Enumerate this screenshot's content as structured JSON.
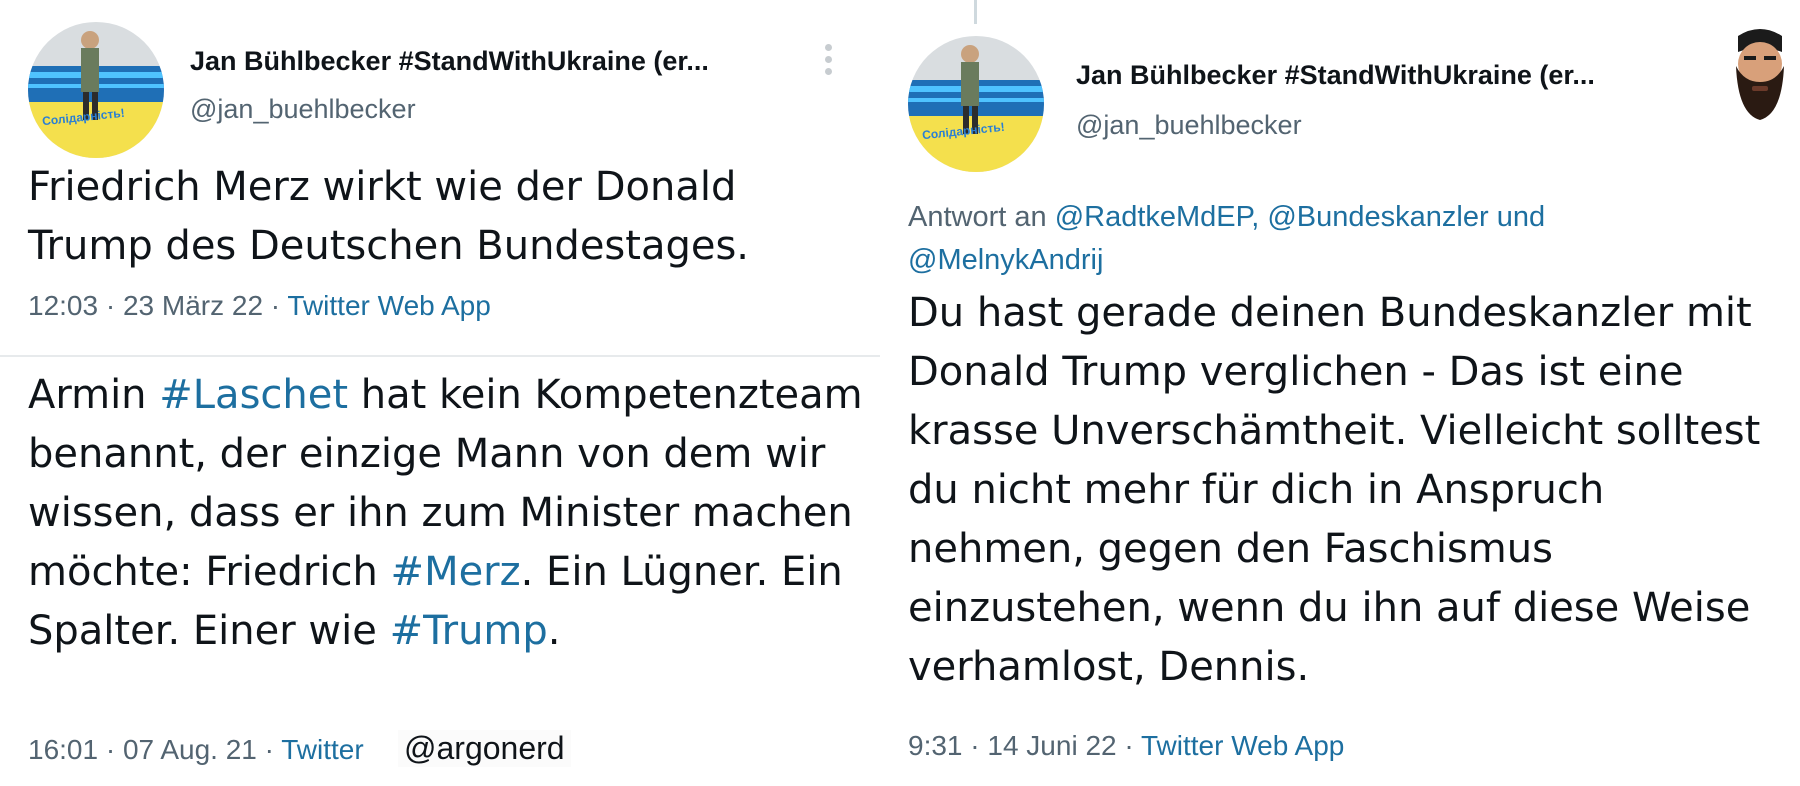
{
  "left_tweet_1": {
    "author_name": "Jan Bühlbecker #StandWithUkraine (er...",
    "handle": "@jan_buehlbecker",
    "avatar_badge": "Солідарність!",
    "text": "Friedrich Merz wirkt wie der Donald Trump des Deutschen Bundestages.",
    "time": "12:03 · 23 März 22 ·",
    "source": "Twitter Web App"
  },
  "left_tweet_2": {
    "text_part1": "Armin ",
    "hashtag1": "#Laschet",
    "text_part2": " hat kein Kompetenzteam benannt, der einzige Mann von dem wir wissen, dass er ihn zum Minister machen möchte: Friedrich ",
    "hashtag2": "#Merz",
    "text_part3": ". Ein Lügner. Ein Spalter. Einer wie ",
    "hashtag3": "#Trump",
    "text_part4": ".",
    "time": "16:01 · 07 Aug. 21 ·",
    "source": "Twitter",
    "watermark": "@argonerd"
  },
  "right_tweet": {
    "author_name": "Jan Bühlbecker #StandWithUkraine (er...",
    "handle": "@jan_buehlbecker",
    "avatar_badge": "Солідарність!",
    "reply_prefix": "Antwort an ",
    "reply_targets": "@RadtkeMdEP, @Bundeskanzler und @MelnykAndrij",
    "text": "Du hast gerade deinen Bundeskanzler mit Donald Trump verglichen - Das ist eine krasse Unverschämtheit. Vielleicht solltest du nicht mehr für dich in Anspruch nehmen, gegen den Faschismus einzustehen, wenn du ihn auf diese Weise verhamlost, Dennis.",
    "time": "9:31 · 14 Juni 22 ·",
    "source": "Twitter Web App"
  },
  "colors": {
    "link": "#1d6fa0",
    "muted": "#536471",
    "text": "#0f1419",
    "badge_yellow": "#f4e04d",
    "badge_blue": "#2a7fd4"
  },
  "icons": [
    "more-options-icon",
    "thread-connector",
    "profile-avatar",
    "bearded-man-emoji"
  ]
}
